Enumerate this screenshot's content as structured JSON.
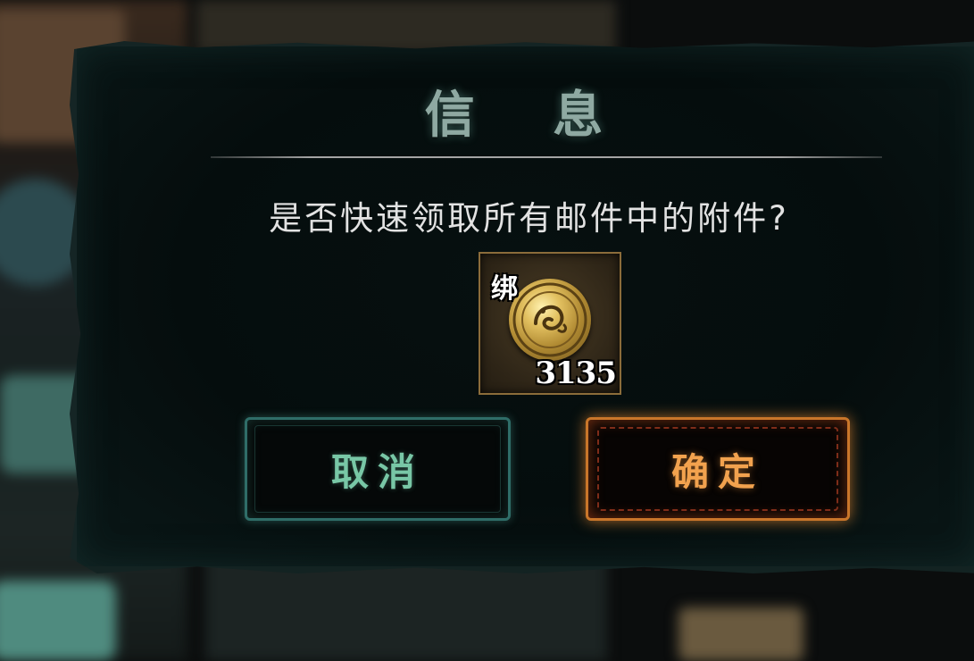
{
  "dialog": {
    "title": "信 息",
    "message": "是否快速领取所有邮件中的附件?",
    "item": {
      "icon": "bronze-coin-icon",
      "bind_label": "绑",
      "count": "3135"
    },
    "buttons": {
      "cancel_label": "取消",
      "confirm_label": "确定"
    }
  },
  "colors": {
    "title": "#8fa9a2",
    "message": "#e2e2e2",
    "cancel_border": "#2f6d68",
    "cancel_text": "#78c7a6",
    "confirm_border": "#c9762a",
    "confirm_text": "#f2a24e",
    "item_border": "#8b6c3a"
  }
}
